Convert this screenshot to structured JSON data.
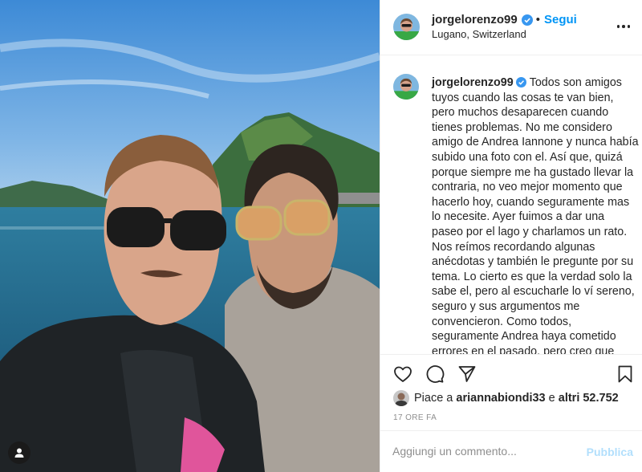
{
  "post": {
    "username": "jorgelorenzo99",
    "follow_label": "Segui",
    "location": "Lugano, Switzerland",
    "caption": "Todos son amigos tuyos cuando las cosas te van bien, pero muchos desaparecen cuando tienes problemas. No me considero amigo de Andrea Iannone y nunca había subido una foto con el. Así que, quizá porque siempre me ha gustado llevar la contraria, no veo mejor momento que hacerlo hoy, cuando seguramente mas lo necesite. Ayer fuimos a dar una paseo por el lago y charlamos un rato. Nos reímos recordando algunas anécdotas y también le pregunte por su tema. Lo cierto es que la verdad solo la sabe el, pero al escucharle lo ví sereno, seguro y sus argumentos me convencieron. Como todos, seguramente Andrea haya cometido errores en el pasado, pero creo que esta vez el \"error\" no ha sido"
  },
  "likes": {
    "prefix": "Piace a",
    "user": "ariannabiondi33",
    "middle": "e",
    "others": "altri 52.752"
  },
  "timestamp": "17 ORE FA",
  "comment": {
    "placeholder": "Aggiungi un commento...",
    "publish_label": "Pubblica"
  },
  "colors": {
    "link_blue": "#0095f6",
    "verified_blue": "#3897f0",
    "publish_disabled": "#b2dffc",
    "muted_text": "#8e8e8e"
  },
  "icons": [
    "verified-badge-icon",
    "more-options-icon",
    "heart-icon",
    "comment-icon",
    "share-icon",
    "bookmark-icon",
    "user-tag-icon"
  ]
}
